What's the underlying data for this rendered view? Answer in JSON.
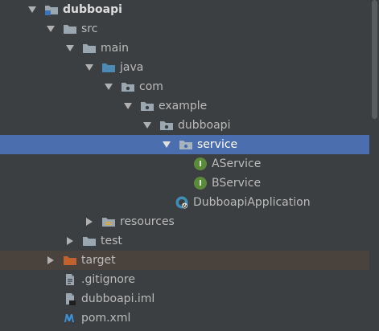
{
  "tree": {
    "root": "dubboapi",
    "src": "src",
    "main": "main",
    "java": "java",
    "com": "com",
    "example": "example",
    "pkg": "dubboapi",
    "service": "service",
    "aservice": "AService",
    "bservice": "BService",
    "app": "DubboapiApplication",
    "resources": "resources",
    "test": "test",
    "target": "target",
    "gitignore": ".gitignore",
    "iml": "dubboapi.iml",
    "pom": "pom.xml"
  },
  "icons": {
    "interface_letter": "I"
  },
  "colors": {
    "background": "#3c3f41",
    "selection": "#4b6eaf",
    "excluded_row": "#4a423d",
    "source_folder": "#4a8ab5",
    "excluded_folder": "#c0622e",
    "interface_badge": "#5b8a3a"
  }
}
